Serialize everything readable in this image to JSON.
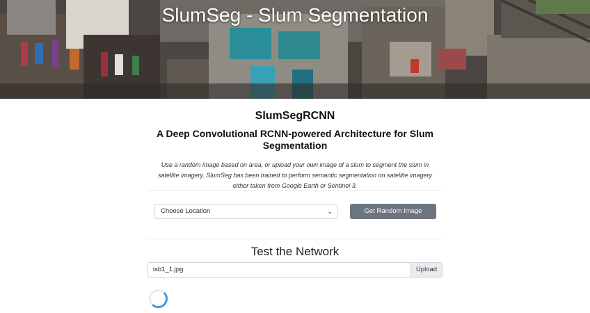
{
  "hero": {
    "title": "SlumSeg - Slum Segmentation"
  },
  "intro": {
    "app_name": "SlumSegRCNN",
    "subtitle": "A Deep Convolutional RCNN-powered Architecture for Slum Segmentation",
    "description": "Use a random image based on area, or upload your own image of a slum to segment the slum in satellite imagery. SlumSeg has been trained to perform semantic segmentation on satellite imagery either taken from Google Earth or Sentinel 3."
  },
  "random": {
    "location_select_value": "Choose Location",
    "button_label": "Get Random Image"
  },
  "test": {
    "title": "Test the Network",
    "file_name": "isb1_1.jpg",
    "upload_label": "Upload"
  },
  "colors": {
    "random_button_bg": "#6c757d",
    "spinner_accent": "#3b9ae1"
  },
  "icons": {
    "select_chevron": "chevron-down-icon",
    "loading": "loading-spinner-icon"
  }
}
